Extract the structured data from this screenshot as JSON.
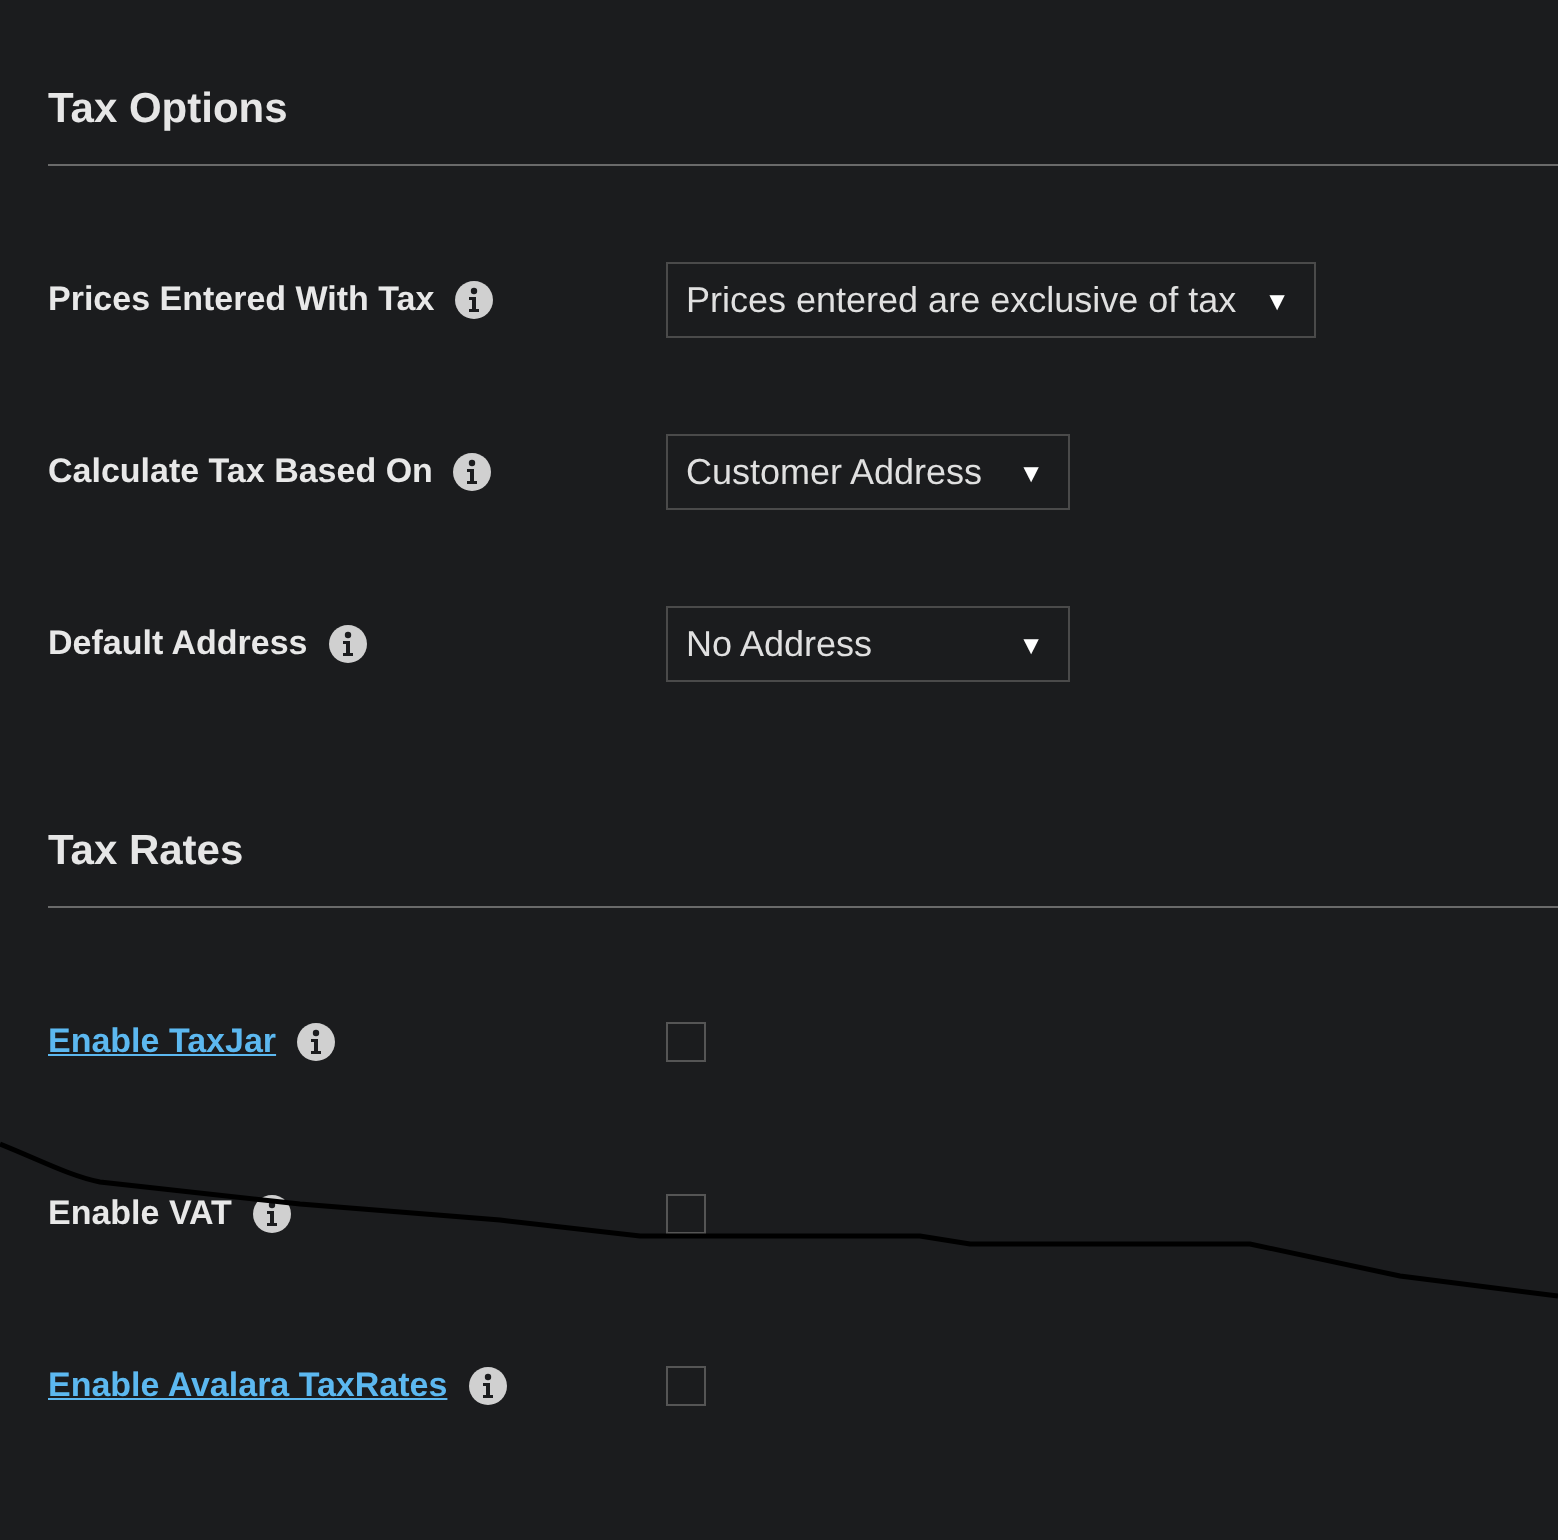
{
  "sections": [
    {
      "title": "Tax Options",
      "rows": [
        {
          "kind": "select",
          "label": "Prices Entered With Tax",
          "link": false,
          "value": "Prices entered are exclusive of tax",
          "caret": "▼"
        },
        {
          "kind": "select",
          "label": "Calculate Tax Based On",
          "link": false,
          "value": "Customer Address",
          "caret": "▼"
        },
        {
          "kind": "select",
          "label": "Default Address",
          "link": false,
          "value": "No Address",
          "caret": "▼"
        }
      ]
    },
    {
      "title": "Tax Rates",
      "rows": [
        {
          "kind": "checkbox",
          "label": "Enable TaxJar",
          "link": true,
          "checked": false
        },
        {
          "kind": "checkbox",
          "label": "Enable VAT",
          "link": false,
          "checked": false
        },
        {
          "kind": "checkbox",
          "label": "Enable Avalara TaxRates",
          "link": true,
          "checked": false
        }
      ]
    }
  ]
}
